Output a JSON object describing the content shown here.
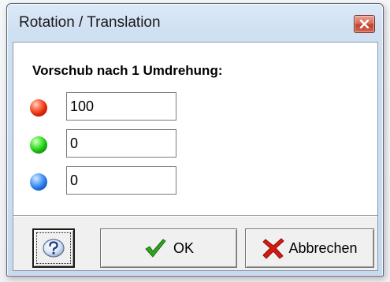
{
  "window": {
    "title": "Rotation / Translation"
  },
  "form": {
    "heading": "Vorschub nach 1 Umdrehung:",
    "fields": [
      {
        "color": "red",
        "value": "100"
      },
      {
        "color": "green",
        "value": "0"
      },
      {
        "color": "blue",
        "value": "0"
      }
    ]
  },
  "buttons": {
    "ok_label": "OK",
    "cancel_label": "Abbrechen"
  },
  "icons": {
    "close": "close-icon",
    "help": "help-icon",
    "ok": "checkmark-icon",
    "cancel": "red-x-icon"
  },
  "colors": {
    "red_ball": "#e1270a",
    "green_ball": "#17b510",
    "blue_ball": "#1f6fe0",
    "checkmark": "#2fa31f",
    "cancel_x": "#d51a10"
  }
}
